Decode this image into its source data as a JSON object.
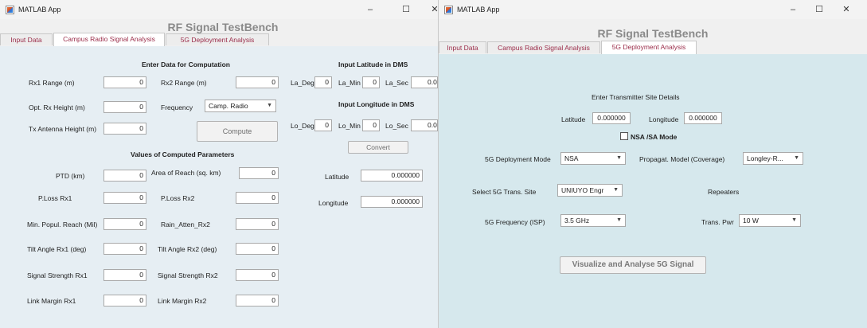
{
  "left_window": {
    "title": "MATLAB App",
    "controls": {
      "minimize": "–",
      "maximize": "☐",
      "close": "✕"
    },
    "app_title": "RF Signal TestBench",
    "tabs": [
      "Input Data",
      "Campus Radio Signal Analysis",
      "5G Deployment Analysis"
    ],
    "active_tab": "Campus Radio Signal Analysis",
    "enter_data": {
      "heading": "Enter Data for Computation",
      "rx1_range": {
        "label": "Rx1 Range (m)",
        "value": "0"
      },
      "rx2_range": {
        "label": "Rx2 Range (m)",
        "value": "0"
      },
      "opt_rx_height": {
        "label": "Opt. Rx Height (m)",
        "value": "0"
      },
      "frequency": {
        "label": "Frequency",
        "value": "Camp. Radio"
      },
      "tx_height": {
        "label": "Tx Antenna Height (m)",
        "value": "0"
      },
      "compute_label": "Compute"
    },
    "dms_lat": {
      "heading": "Input Latitude in DMS",
      "deg_label": "La_Deg",
      "deg": "0",
      "min_label": "La_Min",
      "min": "0",
      "sec_label": "La_Sec",
      "sec": "0.0"
    },
    "dms_lon": {
      "heading": "Input Longitude in DMS",
      "deg_label": "Lo_Deg",
      "deg": "0",
      "min_label": "Lo_Min",
      "min": "0",
      "sec_label": "Lo_Sec",
      "sec": "0.0"
    },
    "convert_label": "Convert",
    "computed": {
      "heading": "Values of Computed Parameters",
      "ptd": {
        "label": "PTD (km)",
        "value": "0"
      },
      "area_reach": {
        "label": "Area of Reach (sq. km)",
        "value": "0"
      },
      "ploss_rx1": {
        "label": "P.Loss Rx1",
        "value": "0"
      },
      "ploss_rx2": {
        "label": "P.Loss Rx2",
        "value": "0"
      },
      "min_popul": {
        "label": "Min. Popul. Reach (Mil)",
        "value": "0"
      },
      "rain_atten": {
        "label": "Rain_Atten_Rx2",
        "value": "0"
      },
      "tilt_rx1": {
        "label": "Tilt Angle Rx1 (deg)",
        "value": "0"
      },
      "tilt_rx2": {
        "label": "Tilt Angle Rx2 (deg)",
        "value": "0"
      },
      "sig_rx1": {
        "label": "Signal Strength Rx1",
        "value": "0"
      },
      "sig_rx2": {
        "label": "Signal Strength Rx2",
        "value": "0"
      },
      "link_rx1": {
        "label": "Link Margin Rx1",
        "value": "0"
      },
      "link_rx2": {
        "label": "Link Margin Rx2",
        "value": "0"
      }
    },
    "latitude": {
      "label": "Latitude",
      "value": "0.000000"
    },
    "longitude": {
      "label": "Longitude",
      "value": "0.000000"
    }
  },
  "right_window": {
    "title": "MATLAB App",
    "controls": {
      "minimize": "–",
      "maximize": "☐",
      "close": "✕"
    },
    "app_title": "RF Signal TestBench",
    "tabs": [
      "Input Data",
      "Campus Radio Signal Analysis",
      "5G Deployment Analysis"
    ],
    "active_tab": "5G Deployment Analysis",
    "site_heading": "Enter Transmitter Site Details",
    "latitude": {
      "label": "Latitude",
      "value": "0.000000"
    },
    "longitude": {
      "label": "Longitude",
      "value": "0.000000"
    },
    "nsa_sa_label": "NSA /SA Mode",
    "nsa_checked": false,
    "deploy_mode": {
      "label": "5G Deployment Mode",
      "value": "NSA"
    },
    "propag_model": {
      "label": "Propagat. Model (Coverage)",
      "value": "Longley-R..."
    },
    "trans_site": {
      "label": "Select 5G Trans. Site",
      "value": "UNIUYO Engr"
    },
    "repeaters_label": "Repeaters",
    "frequency": {
      "label": "5G Frequency (ISP)",
      "value": "3.5 GHz"
    },
    "trans_pwr": {
      "label": "Trans. Pwr",
      "value": "10 W"
    },
    "visualize_label": "Visualize and Analyse  5G Signal"
  },
  "colors": {
    "tab_text": "#9b2d4a",
    "left_panel": "#e6eef3",
    "right_panel": "#d6e8ed",
    "title_gray": "#8a8a8a"
  }
}
